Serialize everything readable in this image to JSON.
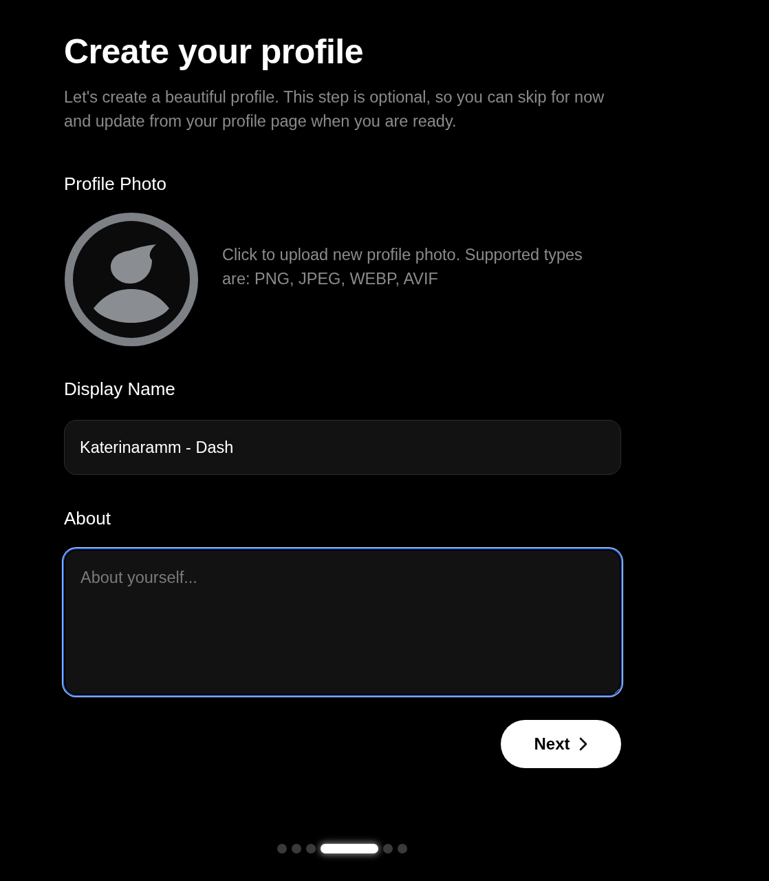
{
  "title": "Create your profile",
  "subtitle": "Let's create a beautiful profile. This step is optional, so you can skip for now and update from your profile page when you are ready.",
  "profile_photo": {
    "label": "Profile Photo",
    "hint": "Click to upload new profile photo. Supported types are: PNG, JPEG, WEBP, AVIF"
  },
  "display_name": {
    "label": "Display Name",
    "value": "Katerinaramm - Dash",
    "focused": false
  },
  "about": {
    "label": "About",
    "placeholder": "About yourself...",
    "focused": true
  },
  "next_button": {
    "label": "Next"
  },
  "steps": [
    {
      "selected": false
    },
    {
      "selected": false
    },
    {
      "selected": false
    },
    {
      "selected": true
    },
    {
      "selected": false
    },
    {
      "selected": false
    }
  ]
}
